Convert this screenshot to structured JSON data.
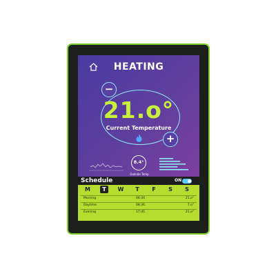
{
  "header": {
    "title": "HEATING",
    "home_icon": "home-icon"
  },
  "thermostat": {
    "current_value": "21.o°",
    "current_label": "Current Temperature",
    "minus_label": "−",
    "plus_label": "+",
    "flame_icon": "flame-icon"
  },
  "outside": {
    "value": "8.4°",
    "label": "Outside Temp"
  },
  "schedule": {
    "title": "Schedule",
    "toggle_label": "ON",
    "days": [
      "M",
      "T",
      "W",
      "T",
      "F",
      "S",
      "S"
    ],
    "active_day_index": 1,
    "rows": [
      {
        "name": "Morning",
        "time": "06:30",
        "temp": "21.o°"
      },
      {
        "name": "Daytime",
        "time": "08:30",
        "temp": "7.o°"
      },
      {
        "name": "Evening",
        "time": "17:45",
        "temp": "21.o°"
      }
    ]
  },
  "colors": {
    "bezel_accent": "#7fd12a",
    "screen_gradient_start": "#4a3ba1",
    "screen_gradient_end": "#7d3fa0",
    "temp_accent": "#c8f03a",
    "ring": "#8ff0ff",
    "schedule_bg": "#b5dc2e",
    "toggle_on": "#5ecbff"
  }
}
